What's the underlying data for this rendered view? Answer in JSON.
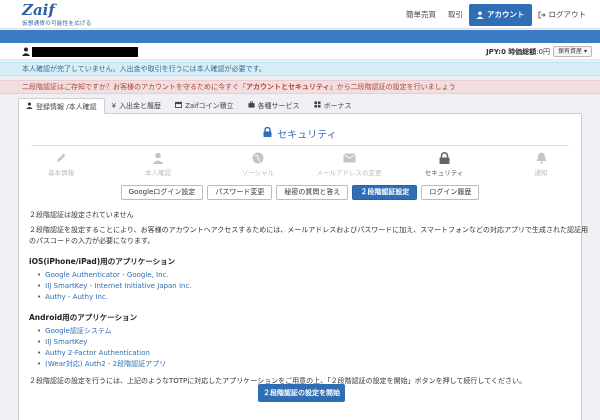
{
  "header": {
    "logo": "Zaif",
    "tagline": "仮想通貨の可能性を広げる",
    "nav": [
      {
        "label": "簡単売買"
      },
      {
        "label": "取引"
      },
      {
        "label": "アカウント"
      },
      {
        "label": "ログアウト"
      }
    ]
  },
  "userbar": {
    "balance_prefix": "JPY:0",
    "balance_label": "時価総額",
    "balance_value": ":0円",
    "assets_button": "保有資産"
  },
  "alerts": {
    "info": "本人確認が完了していません。入出金や取引を行うには本人確認が必要です。",
    "danger_pre": "二段階認証はご存知ですか？お客様のアカウントを守るために今すぐ「",
    "danger_bold": "アカウントとセキュリティ",
    "danger_post": "」から二段階認証の設定を行いましょう"
  },
  "tabs": [
    {
      "label": "登録情報 /本人確認",
      "icon": "user-icon"
    },
    {
      "label": "入出金と履歴",
      "icon": "yen-icon"
    },
    {
      "label": "Zaifコイン積立",
      "icon": "calendar-icon"
    },
    {
      "label": "各種サービス",
      "icon": "briefcase-icon"
    },
    {
      "label": "ボーナス",
      "icon": "grid-icon"
    }
  ],
  "section": {
    "title": "セキュリティ",
    "icon": "lock-icon"
  },
  "steps": [
    {
      "label": "基本情報",
      "icon": "pencil-icon"
    },
    {
      "label": "本人確認",
      "icon": "person-icon"
    },
    {
      "label": "ソーシャル",
      "icon": "globe-icon"
    },
    {
      "label": "メールアドレスの変更",
      "icon": "envelope-icon"
    },
    {
      "label": "セキュリティ",
      "icon": "lock-icon"
    },
    {
      "label": "通知",
      "icon": "bell-icon"
    }
  ],
  "subtabs": [
    {
      "label": "Googleログイン設定"
    },
    {
      "label": "パスワード変更"
    },
    {
      "label": "秘密の質問と答え"
    },
    {
      "label": "２段階認証設定"
    },
    {
      "label": "ログイン履歴"
    }
  ],
  "content": {
    "status": "２段階認証は設定されていません",
    "desc1": "２段階認証を設定することにより、お客様のアカウントへアクセスするためには、メールアドレスおよびパスワードに加え、スマートフォンなどの対応アプリで生成された認証用",
    "desc2": "のパスコードの入力が必要になります。",
    "ios_heading": "iOS(iPhone/iPad)用のアプリケーション",
    "ios_apps": [
      "Google Authenticator - Google, Inc.",
      "IIJ SmartKey - Internet Initiative Japan Inc.",
      "Authy - Authy Inc."
    ],
    "android_heading": "Android用のアプリケーション",
    "android_apps": [
      "Google認証システム",
      "IIJ SmartKey",
      "Authy 2-Factor Authentication",
      "(Wear対応) Auth2 - 2段階認証アプリ"
    ],
    "footer": "２段階認証の設定を行うには、上記のようなTOTPに対応したアプリケーションをご用意の上、「２段階認証の設定を開始」ボタンを押して続行してください。",
    "start_button": "２段階認証の設定を開始"
  }
}
